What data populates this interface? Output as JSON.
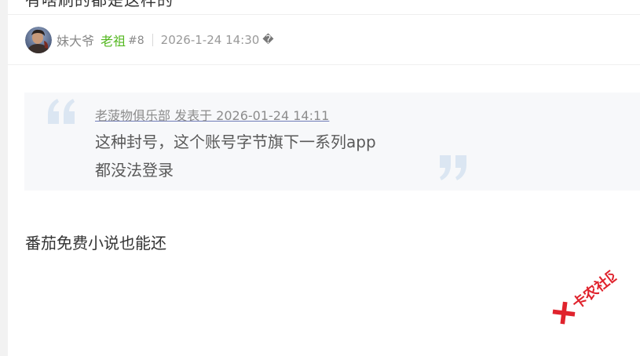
{
  "previous_post": {
    "partial_text": "有啥刷的都是这样的"
  },
  "post": {
    "author": {
      "name": "妹大爷",
      "title": "老祖"
    },
    "floor": "#8",
    "timestamp": "2026-1-24 14:30",
    "timestamp_glyph": "�",
    "quote": {
      "meta": "老菠物俱乐部 发表于 2026-01-24 14:11",
      "lines": [
        "这种封号，这个账号字节旗下一系列app",
        "都没法登录"
      ]
    },
    "body": "番茄免费小说也能还"
  },
  "watermark": {
    "text": "卡农社区"
  },
  "colors": {
    "title_green": "#53b71f",
    "quote_bg": "#f7f8fa",
    "quote_mark": "#dbe6f2",
    "watermark_red": "#e0232d",
    "link_underline": "#6f7bb8"
  }
}
